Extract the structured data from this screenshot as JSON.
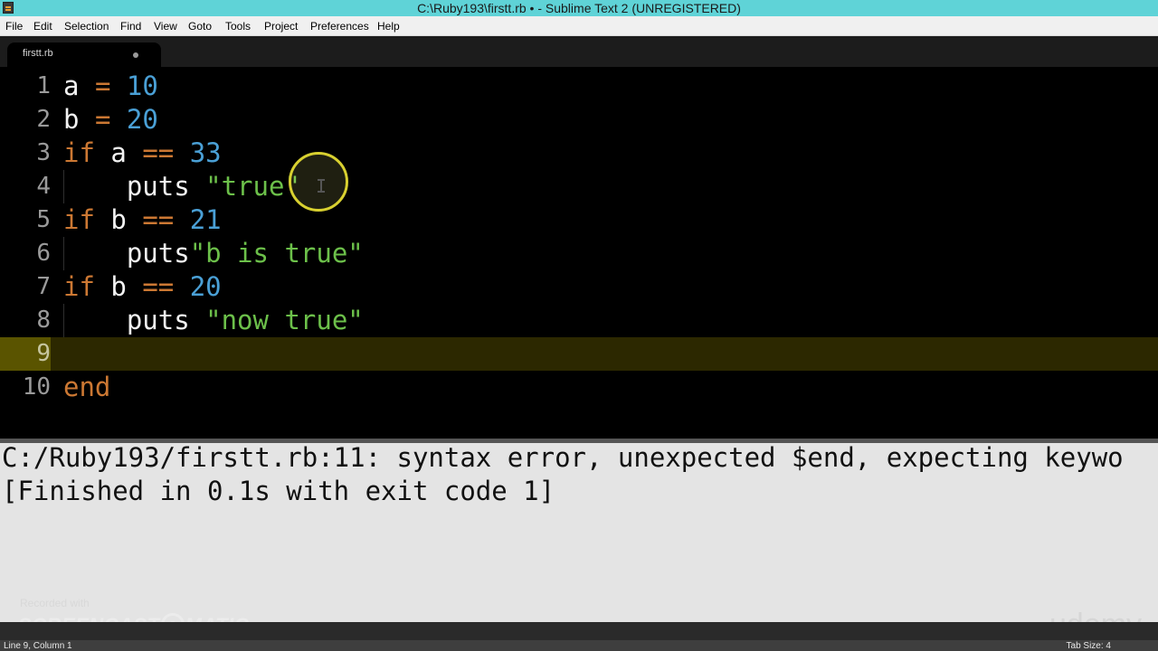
{
  "window": {
    "title": "C:\\Ruby193\\firstt.rb • - Sublime Text 2 (UNREGISTERED)"
  },
  "menu": [
    "File",
    "Edit",
    "Selection",
    "Find",
    "View",
    "Goto",
    "Tools",
    "Project",
    "Preferences",
    "Help"
  ],
  "tab": {
    "label": "firstt.rb",
    "dirty": true
  },
  "editor": {
    "line_numbers": [
      "1",
      "2",
      "3",
      "4",
      "5",
      "6",
      "7",
      "8",
      "9",
      "10"
    ],
    "active_line": 9,
    "lines": [
      [
        {
          "t": "a",
          "c": "id"
        },
        {
          "t": " ",
          "c": "sp"
        },
        {
          "t": "=",
          "c": "op"
        },
        {
          "t": " ",
          "c": "sp"
        },
        {
          "t": "10",
          "c": "num"
        }
      ],
      [
        {
          "t": "b",
          "c": "id"
        },
        {
          "t": " ",
          "c": "sp"
        },
        {
          "t": "=",
          "c": "op"
        },
        {
          "t": " ",
          "c": "sp"
        },
        {
          "t": "20",
          "c": "num"
        }
      ],
      [
        {
          "t": "if",
          "c": "kw"
        },
        {
          "t": " a ",
          "c": "id"
        },
        {
          "t": "==",
          "c": "op"
        },
        {
          "t": " ",
          "c": "sp"
        },
        {
          "t": "33",
          "c": "num"
        }
      ],
      [
        {
          "t": "    puts ",
          "c": "id"
        },
        {
          "t": "\"true\"",
          "c": "str"
        }
      ],
      [
        {
          "t": "if",
          "c": "kw"
        },
        {
          "t": " b ",
          "c": "id"
        },
        {
          "t": "==",
          "c": "op"
        },
        {
          "t": " ",
          "c": "sp"
        },
        {
          "t": "21",
          "c": "num"
        }
      ],
      [
        {
          "t": "    puts",
          "c": "id"
        },
        {
          "t": "\"b is true\"",
          "c": "str"
        }
      ],
      [
        {
          "t": "if",
          "c": "kw"
        },
        {
          "t": " b ",
          "c": "id"
        },
        {
          "t": "==",
          "c": "op"
        },
        {
          "t": " ",
          "c": "sp"
        },
        {
          "t": "20",
          "c": "num"
        }
      ],
      [
        {
          "t": "    puts ",
          "c": "id"
        },
        {
          "t": "\"now true\"",
          "c": "str"
        }
      ],
      [],
      [
        {
          "t": "end",
          "c": "kw"
        }
      ]
    ]
  },
  "output": {
    "lines": [
      "C:/Ruby193/firstt.rb:11: syntax error, unexpected $end, expecting keywo",
      "[Finished in 0.1s with exit code 1]"
    ]
  },
  "status": {
    "left": "Line 9, Column 1",
    "right": "Tab Size: 4"
  },
  "watermark": {
    "recorded": "Recorded with",
    "brand_pre": "SCREENCAST",
    "brand_post": "MATIC",
    "udemy": "udemy"
  },
  "colors": {
    "keyword": "#cc7833",
    "number": "#4aa0d6",
    "string": "#6cc04a",
    "text": "#f2f2f2",
    "title_bar": "#5fd3d7",
    "output_bg": "#e4e4e4"
  }
}
